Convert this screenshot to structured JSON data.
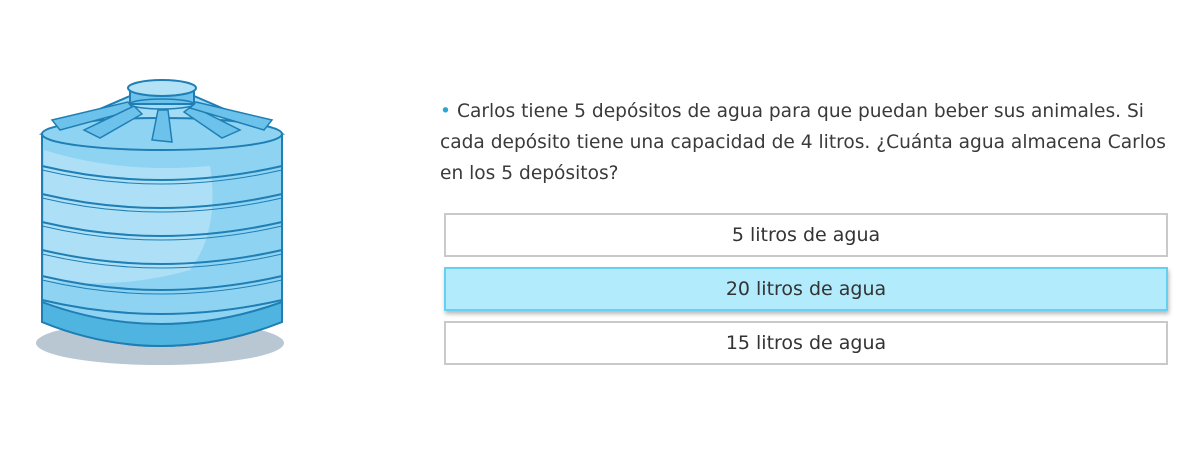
{
  "question": {
    "bullet": "•",
    "text": "Carlos tiene 5 depósitos de agua para que puedan beber sus animales. Si cada depósito tiene una capacidad de 4 litros. ¿Cuánta agua almacena Carlos en los 5 depósitos?"
  },
  "options": [
    {
      "label": "5 litros de agua",
      "selected": false
    },
    {
      "label": "20 litros de agua",
      "selected": true
    },
    {
      "label": "15 litros de agua",
      "selected": false
    }
  ],
  "colors": {
    "accent": "#29a8d6",
    "selected_background": "#b1ebfc",
    "selected_border": "#67cff1",
    "option_border": "#c9c9c9",
    "tank_body": "#8fd3f2",
    "tank_outline": "#1f7fb5"
  },
  "illustration": {
    "icon": "water-tank-icon"
  }
}
